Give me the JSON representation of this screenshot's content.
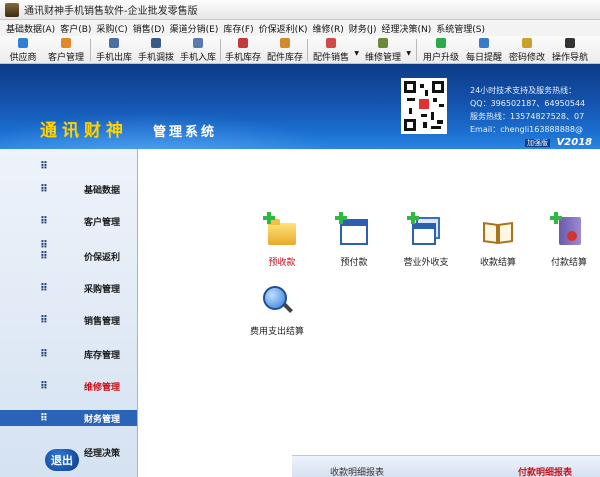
{
  "window": {
    "title": "通讯财神手机销售软件-企业批发零售版"
  },
  "menu": [
    "基础数据(A)",
    "客户(B)",
    "采购(C)",
    "销售(D)",
    "渠道分销(E)",
    "库存(F)",
    "价保返利(K)",
    "维修(R)",
    "财务(J)",
    "经理决策(N)",
    "系统管理(S)"
  ],
  "toolbar": {
    "supplier": "供应商",
    "customer_mgmt": "客户管理",
    "phone_out": "手机出库",
    "phone_transfer": "手机调拨",
    "phone_in": "手机入库",
    "phone_stock": "手机库存",
    "parts_stock": "配件库存",
    "parts_sales": "配件销售",
    "repair_mgmt": "维修管理",
    "user_upgrade": "用户升级",
    "daily_reminder": "每日提醒",
    "change_password": "密码修改",
    "operation_guide": "操作导航"
  },
  "banner": {
    "brand": "通讯财神",
    "system": "管理系统",
    "support_title": "24小时技术支持及服务热线：",
    "qq": "QQ：396502187、64950544",
    "hotline": "服务热线：13574827528、07",
    "email": "Email：chengli163888888@",
    "edition_badge": "加强版",
    "version": "V2018"
  },
  "sidebar": {
    "items": [
      {
        "label": ""
      },
      {
        "label": "基础数据"
      },
      {
        "label": "客户管理"
      },
      {
        "label": ""
      },
      {
        "label": "价保返利"
      },
      {
        "label": "采购管理"
      },
      {
        "label": "销售管理"
      },
      {
        "label": "库存管理"
      },
      {
        "label": "维修管理"
      },
      {
        "label": "财务管理"
      },
      {
        "label": "经理决策"
      }
    ],
    "exit": "退出",
    "dots": "⠿"
  },
  "functions": [
    {
      "label": "预收款"
    },
    {
      "label": "预付款"
    },
    {
      "label": "营业外收支"
    },
    {
      "label": "收款结算"
    },
    {
      "label": "付款结算"
    },
    {
      "label": "费用支出结算"
    }
  ],
  "reports": {
    "receipt_detail": "收款明细报表",
    "payment_detail": "付款明细报表"
  },
  "colors": {
    "accent_blue": "#1453ad",
    "active_red": "#c8101a",
    "brand_yellow": "#ffd200"
  }
}
